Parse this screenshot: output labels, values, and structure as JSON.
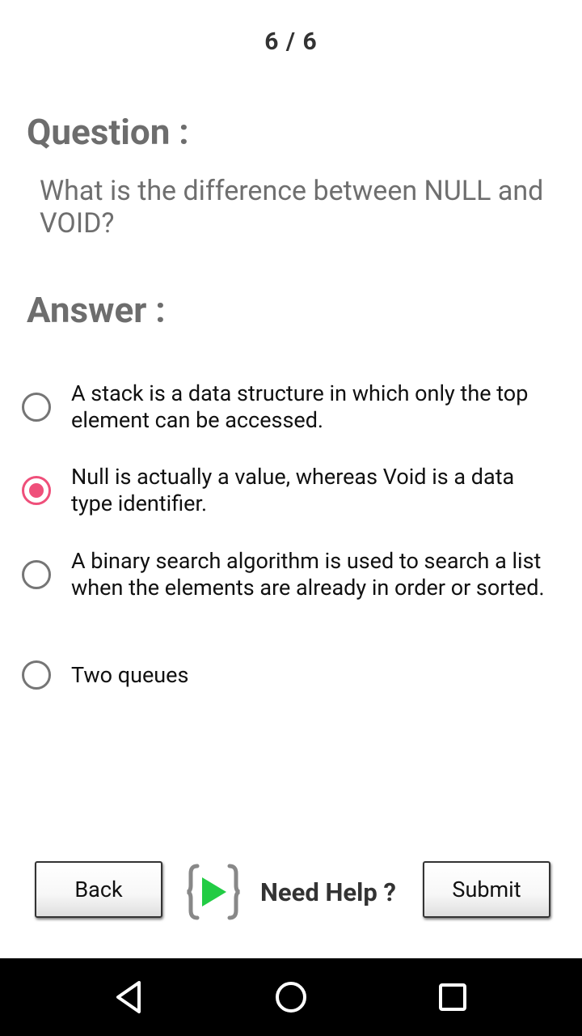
{
  "progress": "6 / 6",
  "question": {
    "title": "Question :",
    "text": "What is the difference between NULL and VOID?"
  },
  "answer": {
    "title": "Answer :",
    "options": [
      {
        "label": "A stack is a data structure in which only the top element can be accessed.",
        "selected": false
      },
      {
        "label": "Null is actually a value, whereas Void is a data type identifier.",
        "selected": true
      },
      {
        "label": "A binary search algorithm is used to search a list when the elements are already in order or sorted.",
        "selected": false
      },
      {
        "label": "Two queues",
        "selected": false
      }
    ]
  },
  "footer": {
    "back_label": "Back",
    "help_label": "Need Help ?",
    "submit_label": "Submit"
  },
  "icons": {
    "help": "code-play-icon",
    "nav_back": "triangle-back-icon",
    "nav_home": "circle-home-icon",
    "nav_recent": "square-recents-icon"
  },
  "colors": {
    "accent": "#ef4f7a",
    "help_play": "#22cc44"
  }
}
